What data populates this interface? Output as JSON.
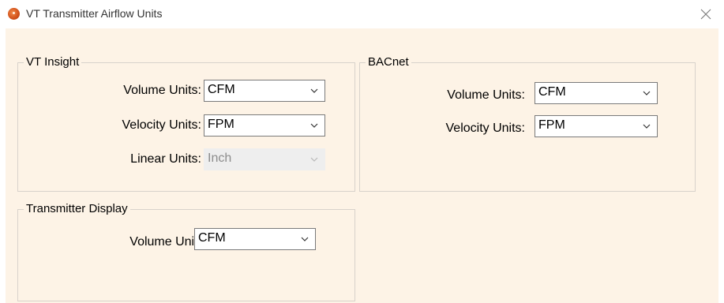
{
  "window": {
    "title": "VT Transmitter Airflow Units",
    "app_icon": "app-logo-icon",
    "close_icon": "close-icon"
  },
  "vt_insight": {
    "title": "VT Insight",
    "volume_label": "Volume Units:",
    "volume_value": "CFM",
    "velocity_label": "Velocity Units:",
    "velocity_value": "FPM",
    "linear_label": "Linear Units:",
    "linear_value": "Inch"
  },
  "bacnet": {
    "title": "BACnet",
    "volume_label": "Volume Units:",
    "volume_value": "CFM",
    "velocity_label": "Velocity Units:",
    "velocity_value": "FPM"
  },
  "transmitter_display": {
    "title": "Transmitter Display",
    "volume_label": "Volume Units:",
    "volume_value": "CFM"
  },
  "colors": {
    "client_background": "#fdf3e6",
    "group_border": "#d8d2cb",
    "disabled_text": "#8c8c8c"
  }
}
